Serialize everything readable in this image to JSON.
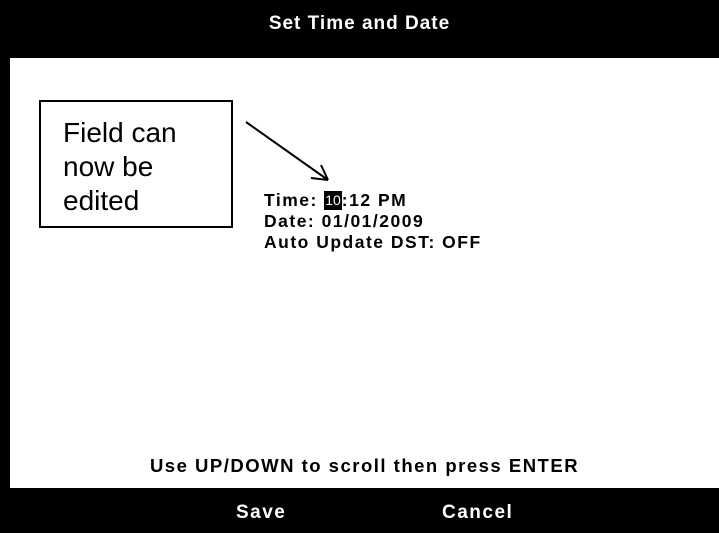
{
  "header": {
    "title": "Set Time and Date"
  },
  "callout": {
    "lines": [
      "Field can",
      "now be",
      "edited"
    ]
  },
  "fields": {
    "time": {
      "label": "Time: ",
      "hour": "10",
      "rest": ":12 PM"
    },
    "date": {
      "label": "Date: ",
      "value": "01/01/2009"
    },
    "dst": {
      "label": "Auto Update DST: ",
      "value": "OFF"
    }
  },
  "hint": "Use UP/DOWN to scroll then press ENTER",
  "soft_keys": {
    "save": "Save",
    "cancel": "Cancel"
  },
  "colors": {
    "background": "#000000",
    "panel": "#ffffff",
    "highlight": "#000000"
  },
  "icons": {
    "callout_pointer": "arrow-icon"
  }
}
